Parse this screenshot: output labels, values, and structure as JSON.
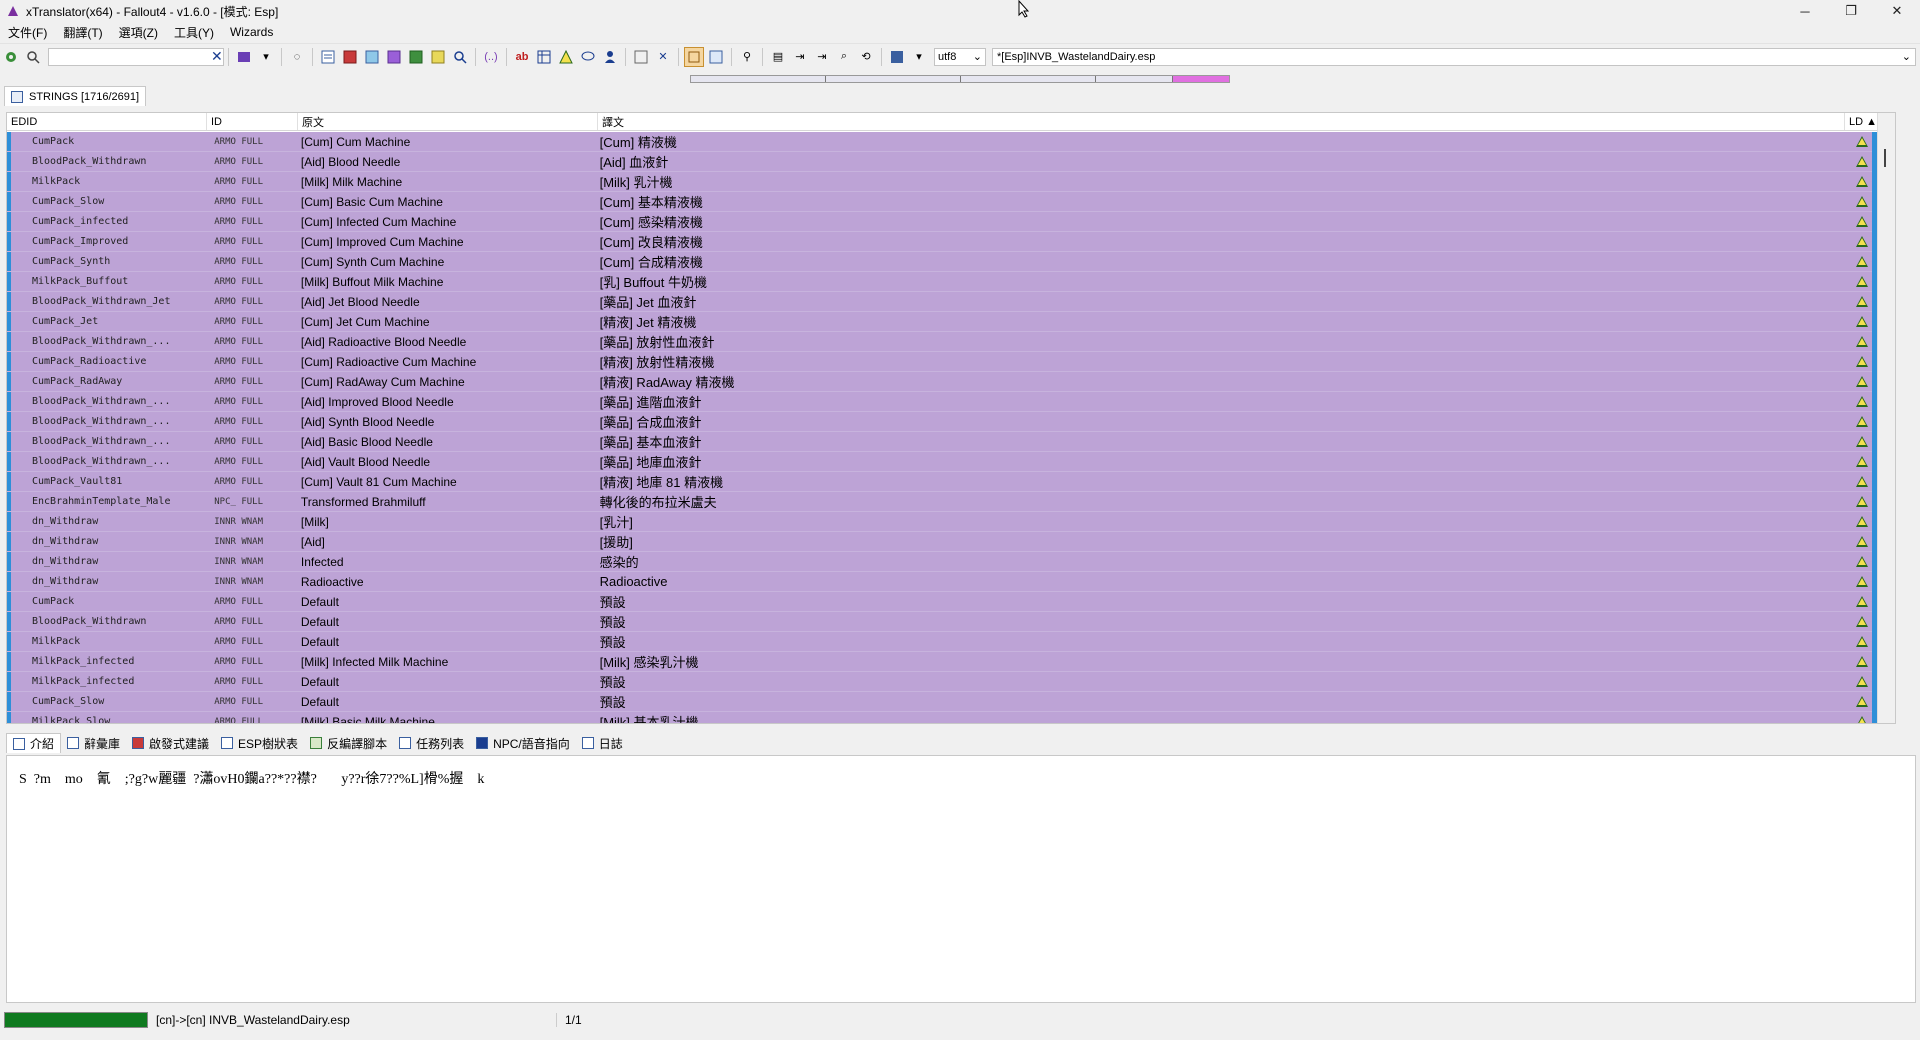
{
  "window": {
    "title": "xTranslator(x64) - Fallout4 - v1.6.0 - [模式: Esp]",
    "minimize": "─",
    "maximize": "❐",
    "close": "✕"
  },
  "menu": [
    "文件(F)",
    "翻譯(T)",
    "選項(Z)",
    "工具(Y)",
    "Wizards"
  ],
  "toolbar": {
    "search_placeholder": "",
    "search_clear": "✕",
    "encoding": "utf8",
    "file": "*[Esp]INVB_WastelandDairy.esp"
  },
  "strings_tab": "STRINGS [1716/2691]",
  "grid": {
    "headers": {
      "edid": "EDID",
      "id": "ID",
      "src": "原文",
      "dst": "譯文",
      "ld": "LD ▲"
    },
    "rows": [
      {
        "edid": "CumPack",
        "id": "ARMO FULL",
        "src": "[Cum] Cum Machine",
        "dst": "[Cum] 精液機"
      },
      {
        "edid": "BloodPack_Withdrawn",
        "id": "ARMO FULL",
        "src": "[Aid] Blood Needle",
        "dst": "[Aid] 血液針"
      },
      {
        "edid": "MilkPack",
        "id": "ARMO FULL",
        "src": "[Milk] Milk Machine",
        "dst": "[Milk] 乳汁機"
      },
      {
        "edid": "CumPack_Slow",
        "id": "ARMO FULL",
        "src": "[Cum] Basic Cum Machine",
        "dst": "[Cum] 基本精液機"
      },
      {
        "edid": "CumPack_infected",
        "id": "ARMO FULL",
        "src": "[Cum] Infected Cum Machine",
        "dst": "[Cum] 感染精液機"
      },
      {
        "edid": "CumPack_Improved",
        "id": "ARMO FULL",
        "src": "[Cum] Improved Cum Machine",
        "dst": "[Cum] 改良精液機"
      },
      {
        "edid": "CumPack_Synth",
        "id": "ARMO FULL",
        "src": "[Cum] Synth Cum Machine",
        "dst": "[Cum] 合成精液機"
      },
      {
        "edid": "MilkPack_Buffout",
        "id": "ARMO FULL",
        "src": "[Milk] Buffout Milk Machine",
        "dst": "[乳] Buffout 牛奶機"
      },
      {
        "edid": "BloodPack_Withdrawn_Jet",
        "id": "ARMO FULL",
        "src": "[Aid] Jet Blood Needle",
        "dst": "[藥品] Jet 血液針"
      },
      {
        "edid": "CumPack_Jet",
        "id": "ARMO FULL",
        "src": "[Cum] Jet Cum Machine",
        "dst": "[精液] Jet 精液機"
      },
      {
        "edid": "BloodPack_Withdrawn_...",
        "id": "ARMO FULL",
        "src": "[Aid] Radioactive Blood Needle",
        "dst": "[藥品] 放射性血液針"
      },
      {
        "edid": "CumPack_Radioactive",
        "id": "ARMO FULL",
        "src": "[Cum] Radioactive Cum Machine",
        "dst": "[精液] 放射性精液機"
      },
      {
        "edid": "CumPack_RadAway",
        "id": "ARMO FULL",
        "src": "[Cum] RadAway Cum Machine",
        "dst": "[精液] RadAway 精液機"
      },
      {
        "edid": "BloodPack_Withdrawn_...",
        "id": "ARMO FULL",
        "src": "[Aid] Improved Blood Needle",
        "dst": "[藥品] 進階血液針"
      },
      {
        "edid": "BloodPack_Withdrawn_...",
        "id": "ARMO FULL",
        "src": "[Aid] Synth Blood Needle",
        "dst": "[藥品] 合成血液針"
      },
      {
        "edid": "BloodPack_Withdrawn_...",
        "id": "ARMO FULL",
        "src": "[Aid] Basic Blood Needle",
        "dst": "[藥品] 基本血液針"
      },
      {
        "edid": "BloodPack_Withdrawn_...",
        "id": "ARMO FULL",
        "src": "[Aid] Vault Blood Needle",
        "dst": "[藥品] 地庫血液針"
      },
      {
        "edid": "CumPack_Vault81",
        "id": "ARMO FULL",
        "src": "[Cum] Vault 81 Cum Machine",
        "dst": "[精液] 地庫 81 精液機"
      },
      {
        "edid": "EncBrahminTemplate_Male",
        "id": "NPC_ FULL",
        "src": "Transformed Brahmiluff",
        "dst": "轉化後的布拉米盧夫"
      },
      {
        "edid": "dn_Withdraw",
        "id": "INNR WNAM",
        "src": "[Milk]",
        "dst": "[乳汁]"
      },
      {
        "edid": "dn_Withdraw",
        "id": "INNR WNAM",
        "src": "[Aid]",
        "dst": "[援助]"
      },
      {
        "edid": "dn_Withdraw",
        "id": "INNR WNAM",
        "src": "Infected",
        "dst": "感染的"
      },
      {
        "edid": "dn_Withdraw",
        "id": "INNR WNAM",
        "src": "Radioactive",
        "dst": "Radioactive"
      },
      {
        "edid": "CumPack",
        "id": "ARMO FULL",
        "src": "Default",
        "dst": "預設"
      },
      {
        "edid": "BloodPack_Withdrawn",
        "id": "ARMO FULL",
        "src": "Default",
        "dst": "預設"
      },
      {
        "edid": "MilkPack",
        "id": "ARMO FULL",
        "src": "Default",
        "dst": "預設"
      },
      {
        "edid": "MilkPack_infected",
        "id": "ARMO FULL",
        "src": "[Milk] Infected Milk Machine",
        "dst": "[Milk] 感染乳汁機"
      },
      {
        "edid": "MilkPack_infected",
        "id": "ARMO FULL",
        "src": "Default",
        "dst": "預設"
      },
      {
        "edid": "CumPack_Slow",
        "id": "ARMO FULL",
        "src": "Default",
        "dst": "預設"
      },
      {
        "edid": "MilkPack_Slow",
        "id": "ARMO FULL",
        "src": "[Milk] Basic Milk Machine",
        "dst": "[Milk] 基本乳汁機"
      }
    ]
  },
  "bottom_tabs": [
    "介紹",
    "辭彙庫",
    "啟發式建議",
    "ESP樹狀表",
    "反編譯腳本",
    "任務列表",
    "NPC/語音指向",
    "日誌"
  ],
  "detail_text": "S  ?m    mo    氰    ;?g?w麗疆  ?瀟ovH0鑭a??*??襟?       y??r徐7??%L]榾%握    k",
  "status": {
    "progress": 1.0,
    "text": "[cn]->[cn] INVB_WastelandDairy.esp",
    "count": "1/1"
  }
}
